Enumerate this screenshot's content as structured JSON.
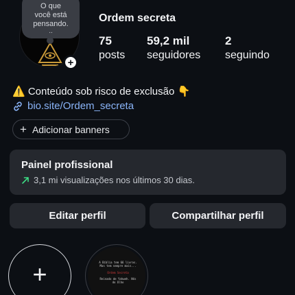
{
  "profile": {
    "username": "Ordem secreta",
    "note": {
      "line1": "O que",
      "line2": "você está",
      "line3": "pensando.",
      "dots": ".."
    },
    "stats": [
      {
        "value": "75",
        "label": "posts"
      },
      {
        "value": "59,2 mil",
        "label": "seguidores"
      },
      {
        "value": "2",
        "label": "seguindo"
      }
    ]
  },
  "bio": {
    "text": "⚠️ Conteúdo sob risco de exclusão 👇",
    "link": "bio.site/Ordem_secreta"
  },
  "banner_chip": {
    "label": "Adicionar banners"
  },
  "professional_panel": {
    "title": "Painel profissional",
    "subtitle": "3,1 mi visualizações nos últimos 30 dias."
  },
  "buttons": {
    "edit": "Editar perfil",
    "share": "Compartilhar perfil"
  },
  "highlights": {
    "new_symbol": "+",
    "story_text": {
      "line1": "A Bíblia tem 66 livros. Mas tem sempre mais...",
      "line2": "Ordem Secreta",
      "line3": "Reinado de Yahweh. Nós do Olho"
    }
  },
  "colors": {
    "background": "#0c0f14",
    "card": "#25282e",
    "link": "#8ab4f8",
    "trend_arrow": "#3ddc84"
  },
  "icons": {
    "add_story": "plus-icon",
    "link": "link-icon",
    "trend": "trend-up-arrow-icon",
    "chip_plus": "plus-icon"
  }
}
